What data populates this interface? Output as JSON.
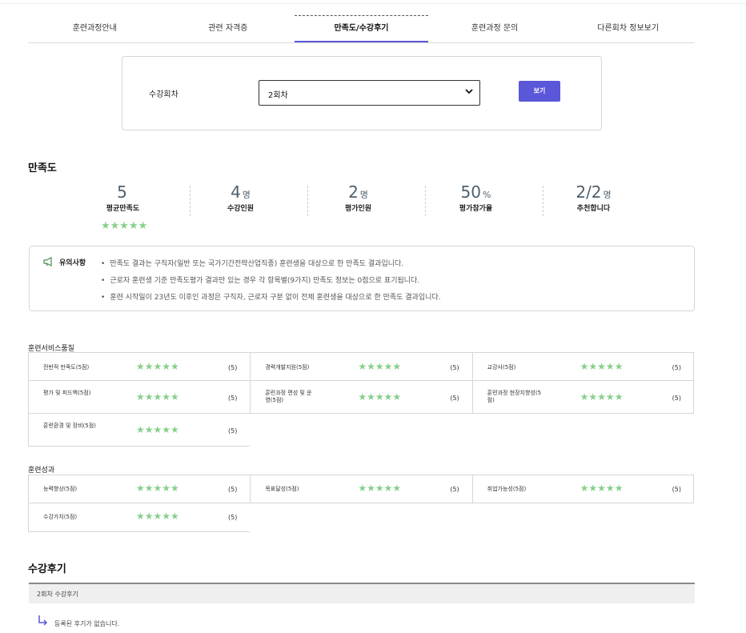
{
  "tabs": [
    {
      "label": "훈련과정안내"
    },
    {
      "label": "관련 자격증"
    },
    {
      "label": "만족도/수강후기"
    },
    {
      "label": "훈련과정 문의"
    },
    {
      "label": "다른회차 정보보기"
    }
  ],
  "active_tab": "만족도/수강후기",
  "selector": {
    "label": "수강회차",
    "value": "2회차",
    "button_label": "보기"
  },
  "satisfaction": {
    "title": "만족도",
    "stats": [
      {
        "value": "5",
        "unit": "",
        "label": "평균만족도"
      },
      {
        "value": "4",
        "unit": "명",
        "label": "수강인원"
      },
      {
        "value": "2",
        "unit": "명",
        "label": "평가인원"
      },
      {
        "value": "50",
        "unit": "%",
        "label": "평가참가율"
      },
      {
        "value": "2/2",
        "unit": "명",
        "label": "추천합니다"
      }
    ],
    "stars": "★★★★★",
    "star_rating": 5
  },
  "notice": {
    "title": "유의사항",
    "items": [
      "만족도 결과는 구직자(일반 또는 국가기간전략산업직종) 훈련생을 대상으로 한 만족도 결과입니다.",
      "근로자 훈련생 기준 만족도평가 결과만 있는 경우 각 항목별(9가지) 만족도 정보는 0점으로 표기됩니다.",
      "훈련 시작일이 23년도 이후인 과정은 구직자, 근로자 구분 없이 전체 훈련생을 대상으로 한 만족도 결과입니다."
    ]
  },
  "service_quality": {
    "title": "훈련서비스품질",
    "items": [
      {
        "label": "전반적 만족도(5점)",
        "stars": "★★★★★",
        "score": "(5)"
      },
      {
        "label": "경력개발지원(5점)",
        "stars": "★★★★★",
        "score": "(5)"
      },
      {
        "label": "교강사(5점)",
        "stars": "★★★★★",
        "score": "(5)"
      },
      {
        "label": "평가 및 피드백(5점)",
        "stars": "★★★★★",
        "score": "(5)"
      },
      {
        "label": "훈련과정 편성 및 운영(5점)",
        "stars": "★★★★★",
        "score": "(5)"
      },
      {
        "label": "훈련과정 현장지향성(5점)",
        "stars": "★★★★★",
        "score": "(5)"
      },
      {
        "label": "훈련환경 및 장비(5점)",
        "stars": "★★★★★",
        "score": "(5)"
      }
    ]
  },
  "outcomes": {
    "title": "훈련성과",
    "items": [
      {
        "label": "능력향상(5점)",
        "stars": "★★★★★",
        "score": "(5)"
      },
      {
        "label": "목표달성(5점)",
        "stars": "★★★★★",
        "score": "(5)"
      },
      {
        "label": "취업가능성(5점)",
        "stars": "★★★★★",
        "score": "(5)"
      },
      {
        "label": "수강가치(5점)",
        "stars": "★★★★★",
        "score": "(5)"
      }
    ]
  },
  "reviews": {
    "title": "수강후기",
    "header": "2회차 수강후기",
    "empty_text": "등록된 후기가 없습니다."
  },
  "colors": {
    "accent": "#5b57d9",
    "star": "#86d08a",
    "stat_number": "#4e5f6d"
  },
  "icons": [
    "chevron-down-icon",
    "megaphone-icon",
    "reply-arrow-icon"
  ]
}
